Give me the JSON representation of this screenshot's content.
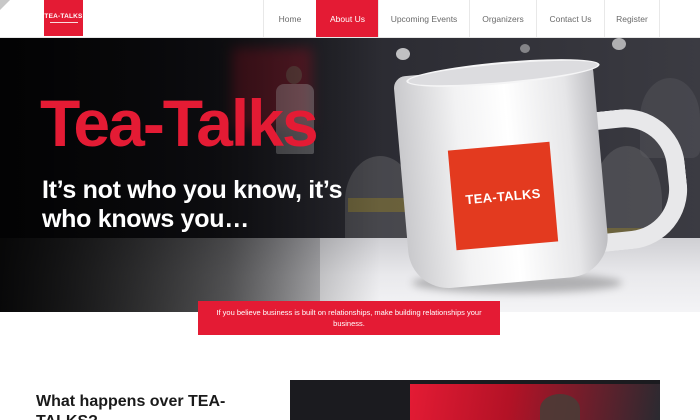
{
  "brand": {
    "logo_text": "TEA-TALKS",
    "color": "#e41b34"
  },
  "nav": {
    "items": [
      {
        "label": "Home",
        "active": false
      },
      {
        "label": "About Us",
        "active": true
      },
      {
        "label": "Upcoming Events",
        "active": false
      },
      {
        "label": "Organizers",
        "active": false
      },
      {
        "label": "Contact Us",
        "active": false
      },
      {
        "label": "Register",
        "active": false
      }
    ]
  },
  "hero": {
    "title": "Tea-Talks",
    "tagline": "It’s not who you know, it’s who knows you…",
    "mug_label": "TEA-TALKS"
  },
  "quote": {
    "text": "If you believe business is built on relationships, make building relationships your business."
  },
  "section": {
    "heading": "What happens over TEA-TALKS?"
  }
}
